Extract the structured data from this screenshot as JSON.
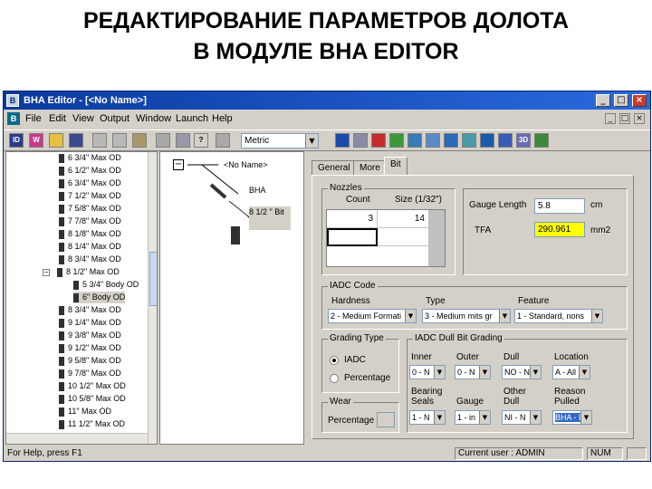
{
  "slide": {
    "title_line1": "РЕДАКТИРОВАНИЕ ПАРАМЕТРОВ ДОЛОТА",
    "title_line2": "В МОДУЛЕ BHA EDITOR"
  },
  "window": {
    "title": "BHA Editor - [<No Name>]",
    "app_icon": "bha-app-icon"
  },
  "menu": [
    "File",
    "Edit",
    "View",
    "Output",
    "Window",
    "Launch",
    "Help"
  ],
  "toolbar": {
    "units": "Metric"
  },
  "tree": {
    "items": [
      "6 3/4\" Max OD",
      "6 1/2\" Max OD",
      "6 3/4\" Max OD",
      "7 1/2\" Max OD",
      "7 5/8\" Max OD",
      "7 7/8\" Max OD",
      "8 1/8\" Max OD",
      "8 1/4\" Max OD",
      "8 3/4\" Max OD",
      "8 1/2\" Max OD",
      "5 3/4\" Body OD",
      "6\" Body OD",
      "8 3/4\" Max OD",
      "9 1/4\" Max OD",
      "9 3/8\" Max OD",
      "9 1/2\" Max OD",
      "9 5/8\" Max OD",
      "9 7/8\" Max OD",
      "10 1/2\" Max OD",
      "10 5/8\" Max OD",
      "11\" Max OD",
      "11 1/2\" Max OD"
    ]
  },
  "graph": {
    "root": "<No Name>",
    "node1": "BHA",
    "node2": "8 1/2 \" Bit"
  },
  "tabs": [
    "General",
    "More",
    "Bit"
  ],
  "nozzles": {
    "group_label": "Nozzles",
    "col_count": "Count",
    "col_size": "Size (1/32\")",
    "rows": [
      {
        "count": "3",
        "size": "14"
      },
      {
        "count": "",
        "size": ""
      }
    ]
  },
  "gauge": {
    "label": "Gauge Length",
    "value": "5.8",
    "unit": "cm"
  },
  "tfa": {
    "label": "TFA",
    "value": "290.961",
    "unit": "mm2"
  },
  "iadc": {
    "group_label": "IADC Code",
    "hardness_label": "Hardness",
    "hardness_value": "2 - Medium Formati",
    "type_label": "Type",
    "type_value": "3 - Medium mits gr",
    "feature_label": "Feature",
    "feature_value": "1 - Standard, nons"
  },
  "grading": {
    "group_label": "Grading Type",
    "opt1": "IADC",
    "opt2": "Percentage",
    "selected": "IADC"
  },
  "dull": {
    "group_label": "IADC Dull Bit Grading",
    "inner_label": "Inner",
    "inner_value": "0 - N",
    "outer_label": "Outer",
    "outer_value": "0 - N",
    "dull_label": "Dull",
    "dull_value": "NO - N",
    "location_label": "Location",
    "location_value": "A - All",
    "bearing_label": "Bearing Seals",
    "bearing_value": "1 - N",
    "gauge_label": "Gauge",
    "gauge_value": "1 - in",
    "other_label": "Other Dull",
    "other_value": "NI - N",
    "reason_label": "Reason Pulled",
    "reason_value": "BHA - E"
  },
  "wear": {
    "group_label": "Wear",
    "label": "Percentage",
    "value": ""
  },
  "status": {
    "help": "For Help, press F1",
    "user": "Current user : ADMIN",
    "num": "NUM"
  }
}
